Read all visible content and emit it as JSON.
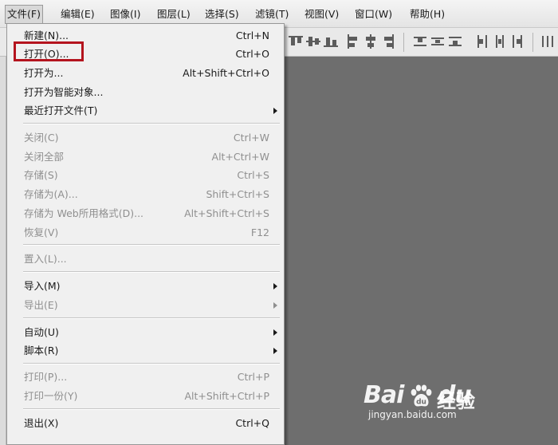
{
  "menubar": {
    "items": [
      {
        "label": "文件(F)",
        "active": true
      },
      {
        "label": "编辑(E)"
      },
      {
        "label": "图像(I)"
      },
      {
        "label": "图层(L)"
      },
      {
        "label": "选择(S)"
      },
      {
        "label": "滤镜(T)"
      },
      {
        "label": "视图(V)"
      },
      {
        "label": "窗口(W)"
      },
      {
        "label": "帮助(H)"
      }
    ]
  },
  "file_menu": {
    "items": [
      {
        "label": "新建(N)...",
        "shortcut": "Ctrl+N",
        "enabled": true
      },
      {
        "label": "打开(O)...",
        "shortcut": "Ctrl+O",
        "enabled": true,
        "highlighted": true
      },
      {
        "label": "打开为...",
        "shortcut": "Alt+Shift+Ctrl+O",
        "enabled": true
      },
      {
        "label": "打开为智能对象...",
        "shortcut": "",
        "enabled": true
      },
      {
        "label": "最近打开文件(T)",
        "shortcut": "",
        "enabled": true,
        "submenu": true
      },
      {
        "label": "关闭(C)",
        "shortcut": "Ctrl+W",
        "enabled": false
      },
      {
        "label": "关闭全部",
        "shortcut": "Alt+Ctrl+W",
        "enabled": false
      },
      {
        "label": "存储(S)",
        "shortcut": "Ctrl+S",
        "enabled": false
      },
      {
        "label": "存储为(A)...",
        "shortcut": "Shift+Ctrl+S",
        "enabled": false
      },
      {
        "label": "存储为 Web所用格式(D)...",
        "shortcut": "Alt+Shift+Ctrl+S",
        "enabled": false
      },
      {
        "label": "恢复(V)",
        "shortcut": "F12",
        "enabled": false
      },
      {
        "label": "置入(L)...",
        "shortcut": "",
        "enabled": false
      },
      {
        "label": "导入(M)",
        "shortcut": "",
        "enabled": true,
        "submenu": true
      },
      {
        "label": "导出(E)",
        "shortcut": "",
        "enabled": false,
        "submenu": true
      },
      {
        "label": "自动(U)",
        "shortcut": "",
        "enabled": true,
        "submenu": true
      },
      {
        "label": "脚本(R)",
        "shortcut": "",
        "enabled": true,
        "submenu": true
      },
      {
        "label": "打印(P)...",
        "shortcut": "Ctrl+P",
        "enabled": false
      },
      {
        "label": "打印一份(Y)",
        "shortcut": "Alt+Shift+Ctrl+P",
        "enabled": false
      },
      {
        "label": "退出(X)",
        "shortcut": "Ctrl+Q",
        "enabled": true
      }
    ]
  },
  "colors": {
    "highlight_border": "#b4141e",
    "canvas_bg": "#6e6e6e",
    "disabled_text": "#8f8f8f"
  },
  "watermark": {
    "logo": "Bai",
    "logo_suffix": "du",
    "cn_text": "经验",
    "url": "jingyan.baidu.com",
    "icon": "baidu-paw-icon"
  }
}
